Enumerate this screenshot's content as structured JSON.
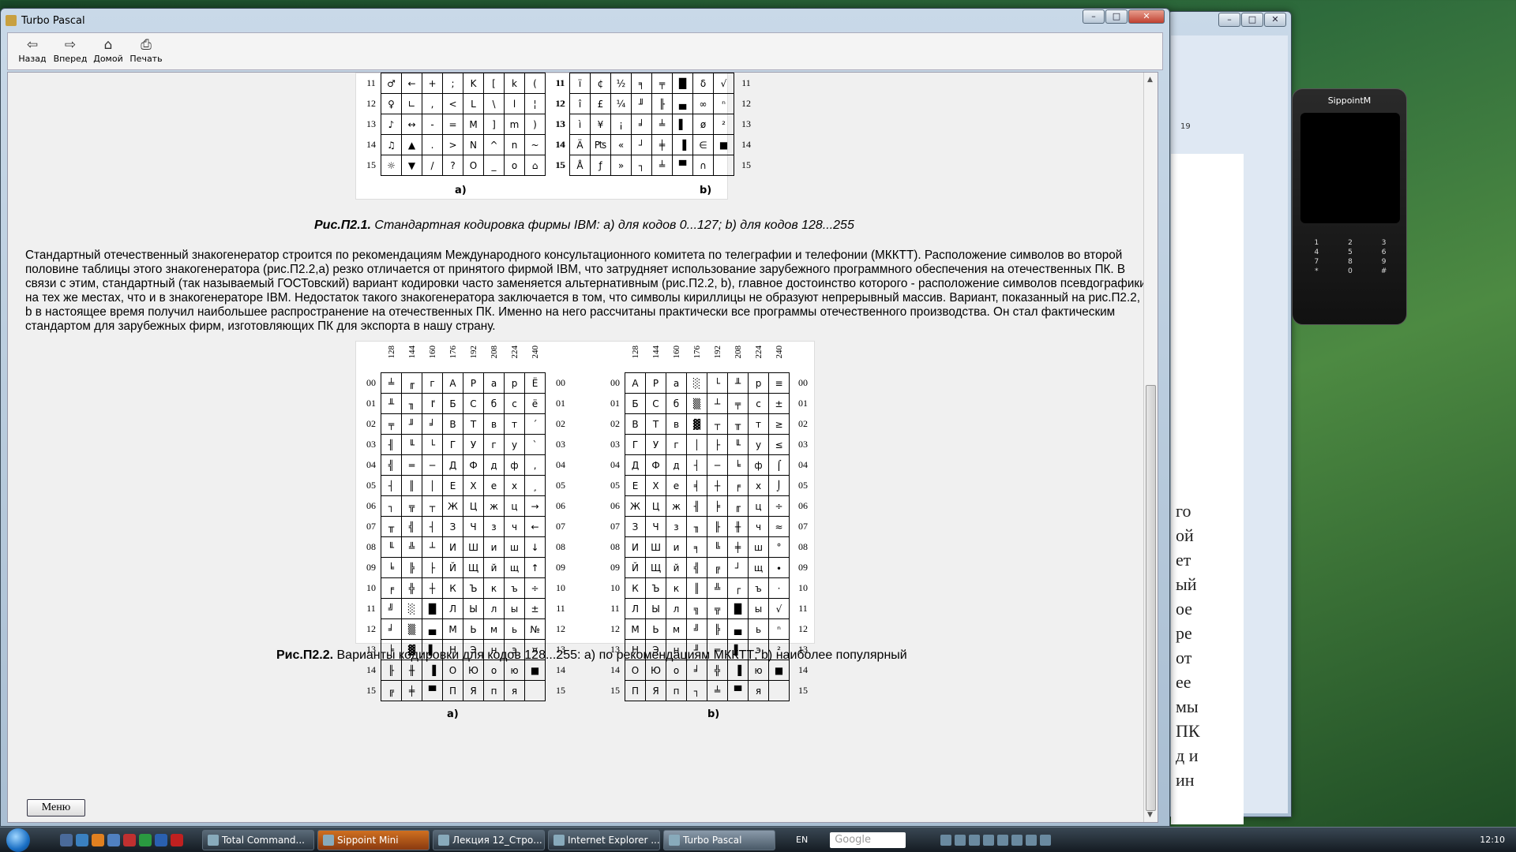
{
  "window": {
    "title": "Turbo Pascal",
    "buttons": [
      "–",
      "□",
      "✕"
    ]
  },
  "toolbar": [
    {
      "label": "Назад",
      "icon": "back-arrow-icon",
      "glyph": "⇦"
    },
    {
      "label": "Вперед",
      "icon": "forward-arrow-icon",
      "glyph": "⇨"
    },
    {
      "label": "Домой",
      "icon": "home-icon",
      "glyph": "⌂"
    },
    {
      "label": "Печать",
      "icon": "printer-icon",
      "glyph": "⎙"
    }
  ],
  "fig1": {
    "caption_bold": "Рис.П2.1.",
    "caption_text": " Стандартная кодировка фирмы IBM: a) для кодов 0...127; b) для кодов 128...255",
    "a_rows": [
      "11",
      "12",
      "13",
      "14",
      "15"
    ],
    "a_cells": [
      [
        "♂",
        "←",
        "+",
        ";",
        "K",
        "[",
        "k",
        "("
      ],
      [
        "♀",
        "∟",
        ",",
        "<",
        "L",
        "\\",
        "l",
        "¦"
      ],
      [
        "♪",
        "↔",
        "-",
        "=",
        "M",
        "]",
        "m",
        ")"
      ],
      [
        "♫",
        "▲",
        ".",
        ">",
        "N",
        "^",
        "n",
        "~"
      ],
      [
        "☼",
        "▼",
        "/",
        "?",
        "O",
        "_",
        "o",
        "⌂"
      ]
    ],
    "b_rows": [
      "11",
      "12",
      "13",
      "14",
      "15"
    ],
    "b_cells": [
      [
        "ï",
        "¢",
        "½",
        "╕",
        "╤",
        "█",
        "δ",
        "√"
      ],
      [
        "î",
        "£",
        "¼",
        "╜",
        "╟",
        "▄",
        "∞",
        "ⁿ"
      ],
      [
        "ì",
        "¥",
        "¡",
        "╛",
        "╧",
        "▌",
        "ø",
        "²"
      ],
      [
        "Ä",
        "₧",
        "«",
        "┘",
        "╪",
        "▐",
        "∈",
        "■"
      ],
      [
        "Å",
        "ƒ",
        "»",
        "┐",
        "╧",
        "▀",
        "∩",
        ""
      ]
    ],
    "label_a": "a)",
    "label_b": "b)"
  },
  "paragraph": "Стандартный отечественный знакогенератор строится по рекомендациям Международного консультационного комитета по телеграфии и телефонии (МККТТ). Расположение символов во второй половине таблицы этого знакогенератора (рис.П2.2,а) резко отличается от принятого фирмой IBM, что затрудняет использование зарубежного программного обеспечения на отечественных ПК. В связи с этим, стандартный (так называемый ГОСТовский) вариант кодировки часто заменяется альтернативным (рис.П2.2, b), главное достоинство которого - расположение символов псевдографики на тех же местах, что и в знакогенераторе IBM. Недостаток такого знакогенератора заключается в том, что символы кириллицы не образуют непрерывный массив. Вариант, показанный на рис.П2.2, b в настоящее время получил наибольшее распространение на отечественных ПК. Именно на него рассчитаны практически все программы отечественного производства. Он стал фактическим стандартом для зарубежных фирм, изготовляющих ПК для экспорта в нашу страну.",
  "fig2": {
    "caption_bold": "Рис.П2.2.",
    "caption_text": " Варианты кодировки для кодов 128...255: a) по рекомендациям МККТТ; b) наиболее популярный",
    "col_headers": [
      "128",
      "144",
      "160",
      "176",
      "192",
      "208",
      "224",
      "240"
    ],
    "rows": [
      "00",
      "01",
      "02",
      "03",
      "04",
      "05",
      "06",
      "07",
      "08",
      "09",
      "10",
      "11",
      "12",
      "13",
      "14",
      "15"
    ],
    "a_cells": [
      [
        "╧",
        "╓",
        "г",
        "",
        "А",
        "Р",
        "а",
        "р",
        "Ё"
      ],
      [
        "╨",
        "╖",
        "ٵ",
        "Б",
        "С",
        "б",
        "с",
        "ё"
      ],
      [
        "╤",
        "╜",
        "╛",
        "В",
        "Т",
        "в",
        "т",
        "´"
      ],
      [
        "╢",
        "╙",
        "└",
        "Г",
        "У",
        "г",
        "у",
        "`"
      ],
      [
        "╣",
        "═",
        "─",
        "Д",
        "Ф",
        "д",
        "ф",
        "‚"
      ],
      [
        "┤",
        "║",
        "│",
        "Е",
        "Х",
        "е",
        "х",
        "¸"
      ],
      [
        "┐",
        "╦",
        "┬",
        "Ж",
        "Ц",
        "ж",
        "ц",
        "→"
      ],
      [
        "╥",
        "╣",
        "┤",
        "З",
        "Ч",
        "з",
        "ч",
        "←"
      ],
      [
        "╙",
        "╩",
        "┴",
        "И",
        "Ш",
        "и",
        "ш",
        "↓"
      ],
      [
        "╘",
        "╠",
        "├",
        "Й",
        "Щ",
        "й",
        "щ",
        "↑"
      ],
      [
        "╒",
        "╬",
        "┼",
        "К",
        "Ъ",
        "к",
        "ъ",
        "÷"
      ],
      [
        "╝",
        "░",
        "█",
        "Л",
        "Ы",
        "л",
        "ы",
        "±"
      ],
      [
        "╛",
        "▒",
        "▄",
        "М",
        "Ь",
        "м",
        "ь",
        "№"
      ],
      [
        "╞",
        "▓",
        "▌",
        "Н",
        "Э",
        "н",
        "э",
        "¤"
      ],
      [
        "╟",
        "╫",
        "▐",
        "О",
        "Ю",
        "о",
        "ю",
        "■"
      ],
      [
        "╔",
        "╪",
        "▀",
        "П",
        "Я",
        "п",
        "я",
        ""
      ]
    ],
    "b_cells": [
      [
        "А",
        "Р",
        "а",
        "░",
        "└",
        "╨",
        "р",
        "≡"
      ],
      [
        "Б",
        "С",
        "б",
        "▒",
        "┴",
        "╤",
        "с",
        "±"
      ],
      [
        "В",
        "Т",
        "в",
        "▓",
        "┬",
        "╥",
        "т",
        "≥"
      ],
      [
        "Г",
        "У",
        "г",
        "│",
        "├",
        "╙",
        "у",
        "≤"
      ],
      [
        "Д",
        "Ф",
        "д",
        "┤",
        "─",
        "╘",
        "ф",
        "⌠"
      ],
      [
        "Е",
        "Х",
        "е",
        "╡",
        "┼",
        "╒",
        "х",
        "⌡"
      ],
      [
        "Ж",
        "Ц",
        "ж",
        "╢",
        "╞",
        "╓",
        "ц",
        "÷"
      ],
      [
        "З",
        "Ч",
        "з",
        "╖",
        "╟",
        "╫",
        "ч",
        "≈"
      ],
      [
        "И",
        "Ш",
        "и",
        "╕",
        "╚",
        "╪",
        "ш",
        "°"
      ],
      [
        "Й",
        "Щ",
        "й",
        "╣",
        "╔",
        "┘",
        "щ",
        "∙"
      ],
      [
        "К",
        "Ъ",
        "к",
        "║",
        "╩",
        "┌",
        "ъ",
        "·"
      ],
      [
        "Л",
        "Ы",
        "л",
        "╗",
        "╦",
        "█",
        "ы",
        "√"
      ],
      [
        "М",
        "Ь",
        "м",
        "╝",
        "╠",
        "▄",
        "ь",
        "ⁿ"
      ],
      [
        "Н",
        "Э",
        "н",
        "╜",
        "═",
        "▌",
        "э",
        "²"
      ],
      [
        "О",
        "Ю",
        "о",
        "╛",
        "╬",
        "▐",
        "ю",
        "■"
      ],
      [
        "П",
        "Я",
        "п",
        "┐",
        "╧",
        "▀",
        "я",
        ""
      ]
    ],
    "label_a": "a)",
    "label_b": "b)"
  },
  "menu_button": "Меню",
  "phone": {
    "title": "SippointM",
    "keys": [
      "1",
      "2",
      "3",
      "4",
      "5",
      "6",
      "7",
      "8",
      "9",
      "*",
      "0",
      "#"
    ]
  },
  "word_page_text": [
    "го",
    "ой",
    "ет",
    "ый",
    "ое",
    "ре",
    "от",
    "ее",
    "мы",
    "ПК",
    "д и",
    "ин"
  ],
  "word_zoom": "19",
  "taskbar": {
    "tasks": [
      "Total Command...",
      "Sippoint Mini",
      "Лекция 12_Стро...",
      "Internet Explorer ...",
      "Turbo Pascal"
    ],
    "lang": "EN",
    "search_placeholder": "Google",
    "clock": "12:10"
  }
}
